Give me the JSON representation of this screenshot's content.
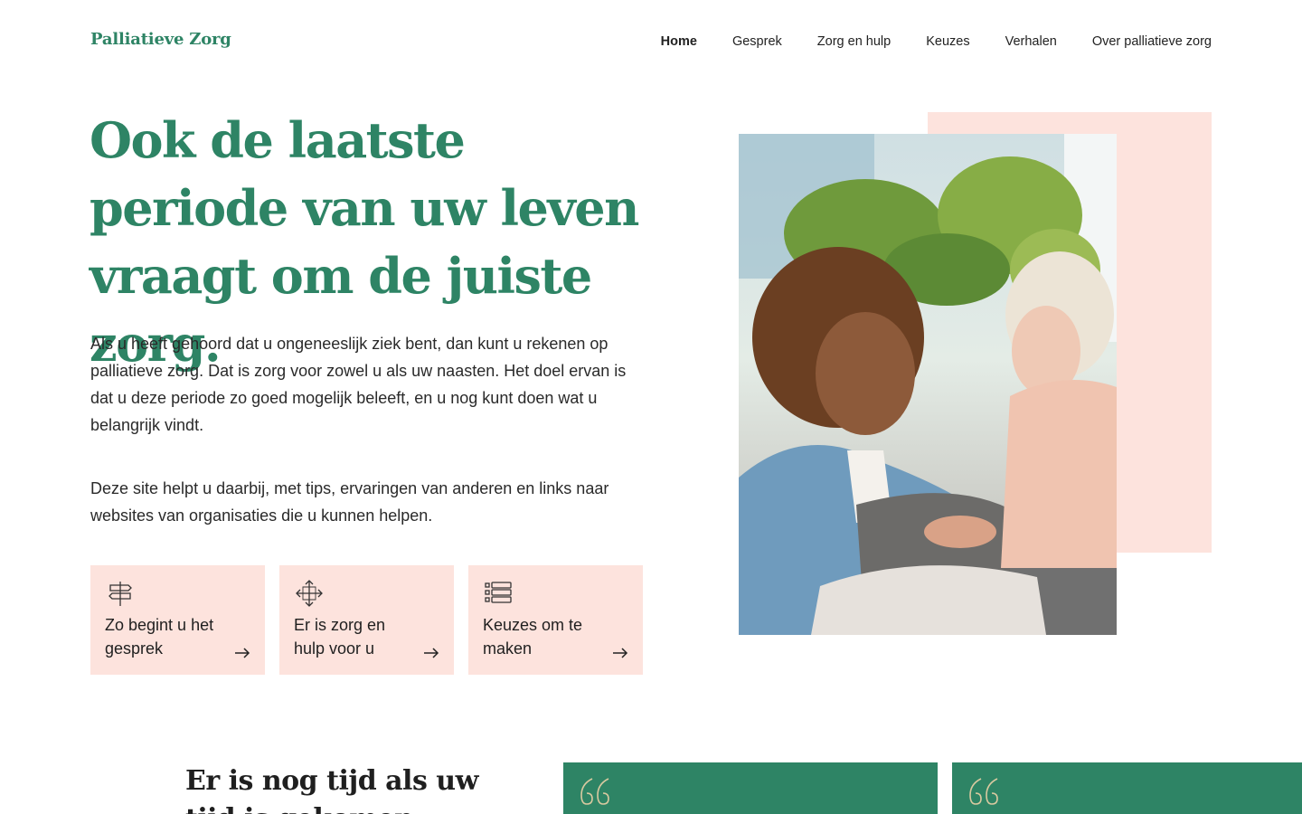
{
  "brand": {
    "logo": "Palliatieve Zorg",
    "color": "#2e8465",
    "accent_pink": "#fde3dd"
  },
  "nav": {
    "items": [
      {
        "label": "Home",
        "active": true
      },
      {
        "label": "Gesprek"
      },
      {
        "label": "Zorg en hulp"
      },
      {
        "label": "Keuzes"
      },
      {
        "label": "Verhalen"
      },
      {
        "label": "Over palliatieve zorg"
      }
    ]
  },
  "hero": {
    "title": "Ook de laatste periode van uw leven vraagt om de juiste zorg.",
    "paragraph_1": "Als u heeft gehoord dat u ongeneeslijk ziek bent, dan kunt u rekenen op palliatieve zorg. Dat is zorg voor zowel u als uw naasten. Het doel ervan is dat u deze periode zo goed mogelijk beleeft, en u nog kunt doen wat u belangrijk vindt.",
    "paragraph_2": "Deze site helpt u daarbij, met tips, ervaringen van anderen en links naar websites van organisaties die u kunnen helpen."
  },
  "cards": [
    {
      "label": "Zo begint u het gesprek",
      "icon": "signpost-icon"
    },
    {
      "label": "Er is zorg en hulp voor u",
      "icon": "directions-icon"
    },
    {
      "label": "Keuzes om te maken",
      "icon": "checklist-icon"
    }
  ],
  "image": {
    "subject": "caregiver-with-elderly-woman-photo"
  },
  "section": {
    "title": "Er is nog tijd als uw tijd is gekomen"
  },
  "quotes": [
    {
      "icon": "quote-icon"
    },
    {
      "icon": "quote-icon"
    }
  ]
}
